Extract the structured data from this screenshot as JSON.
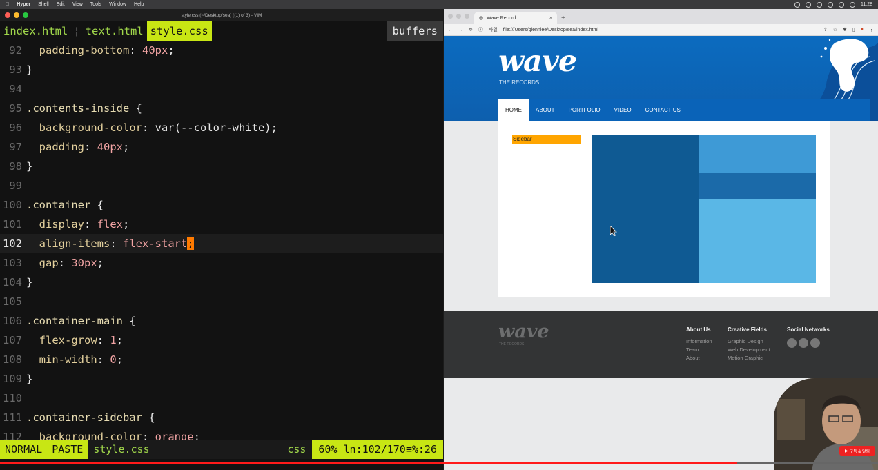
{
  "menubar": {
    "app": "Hyper",
    "items": [
      "Shell",
      "Edit",
      "View",
      "Tools",
      "Window",
      "Help"
    ],
    "clock": "11:28"
  },
  "terminal": {
    "title": "style.css (~/Desktop/sea) ((1) of 3) - VIM",
    "tabs": [
      "index.html",
      "text.html",
      "style.css"
    ],
    "tab_separator": "¦",
    "buffers_label": "buffers",
    "lines": [
      {
        "n": "92",
        "text": "  padding-bottom: 40px;"
      },
      {
        "n": "93",
        "text": "}"
      },
      {
        "n": "94",
        "text": ""
      },
      {
        "n": "95",
        "text": ".contents-inside {"
      },
      {
        "n": "96",
        "text": "  background-color: var(--color-white);"
      },
      {
        "n": "97",
        "text": "  padding: 40px;"
      },
      {
        "n": "98",
        "text": "}"
      },
      {
        "n": "99",
        "text": ""
      },
      {
        "n": "100",
        "text": ".container {"
      },
      {
        "n": "101",
        "text": "  display: flex;"
      },
      {
        "n": "102",
        "text": "  align-items: flex-start;"
      },
      {
        "n": "103",
        "text": "  gap: 30px;"
      },
      {
        "n": "104",
        "text": "}"
      },
      {
        "n": "105",
        "text": ""
      },
      {
        "n": "106",
        "text": ".container-main {"
      },
      {
        "n": "107",
        "text": "  flex-grow: 1;"
      },
      {
        "n": "108",
        "text": "  min-width: 0;"
      },
      {
        "n": "109",
        "text": "}"
      },
      {
        "n": "110",
        "text": ""
      },
      {
        "n": "111",
        "text": ".container-sidebar {"
      },
      {
        "n": "112",
        "text": "  background-color: orange;"
      }
    ],
    "status": {
      "mode": "NORMAL",
      "paste": "PASTE",
      "file": "style.css",
      "filetype": "css",
      "position": "60%  ln:102/170≡%:26"
    }
  },
  "video_progress": 0.84,
  "browser": {
    "tab_title": "Wave Record",
    "url_prefix": "파일",
    "url": "file:///Users/glenniee/Desktop/sea/index.html",
    "site": {
      "logo": "wave",
      "logo_sub": "THE RECORDS",
      "nav": [
        "HOME",
        "ABOUT",
        "PORTFOLIO",
        "VIDEO",
        "CONTACT US"
      ],
      "sidebar_label": "Sidebar",
      "footer": {
        "logo": "wave",
        "logo_sub": "THE RECORDS",
        "columns": [
          {
            "title": "About Us",
            "items": [
              "Information",
              "Team",
              "About"
            ]
          },
          {
            "title": "Creative Fields",
            "items": [
              "Graphic Design",
              "Web Development",
              "Motion Graphic"
            ]
          },
          {
            "title": "Social Networks",
            "items": []
          }
        ],
        "social_icons": [
          "twitter-icon",
          "facebook-icon",
          "pinterest-icon"
        ]
      }
    }
  },
  "overlay": {
    "subscribe_label": "구독 & 알림"
  }
}
